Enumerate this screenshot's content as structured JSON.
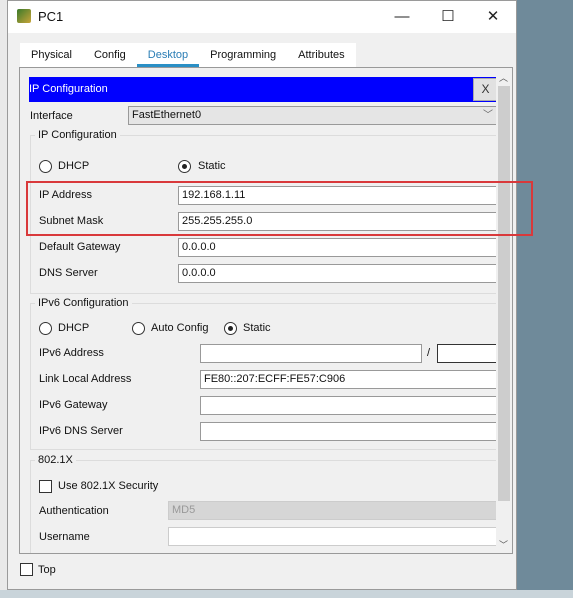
{
  "window": {
    "title": "PC1",
    "minimize": "—",
    "maximize": "☐",
    "close": "✕"
  },
  "tabs": [
    {
      "label": "Physical"
    },
    {
      "label": "Config"
    },
    {
      "label": "Desktop",
      "active": true
    },
    {
      "label": "Programming"
    },
    {
      "label": "Attributes"
    }
  ],
  "header": {
    "title": "IP Configuration",
    "close": "X",
    "color": "#0000ff"
  },
  "interface": {
    "label": "Interface",
    "value": "FastEthernet0"
  },
  "ipv4": {
    "group": "IP Configuration",
    "dhcp": "DHCP",
    "static": "Static",
    "mode": "Static",
    "ip_label": "IP Address",
    "ip": "192.168.1.11",
    "mask_label": "Subnet Mask",
    "mask": "255.255.255.0",
    "gw_label": "Default Gateway",
    "gw": "0.0.0.0",
    "dns_label": "DNS Server",
    "dns": "0.0.0.0"
  },
  "ipv6": {
    "group": "IPv6 Configuration",
    "dhcp": "DHCP",
    "auto": "Auto Config",
    "static": "Static",
    "mode": "Static",
    "addr_label": "IPv6 Address",
    "addr": "",
    "slash": "/",
    "prefix": "",
    "ll_label": "Link Local Address",
    "ll": "FE80::207:ECFF:FE57:C906",
    "gw_label": "IPv6 Gateway",
    "gw": "",
    "dns_label": "IPv6 DNS Server",
    "dns": ""
  },
  "dot1x": {
    "group": "802.1X",
    "use_label": "Use 802.1X Security",
    "checked": false,
    "auth_label": "Authentication",
    "auth": "MD5",
    "user_label": "Username",
    "user": ""
  },
  "footer": {
    "top_label": "Top",
    "checked": false
  },
  "highlight_color": "#d9393b"
}
